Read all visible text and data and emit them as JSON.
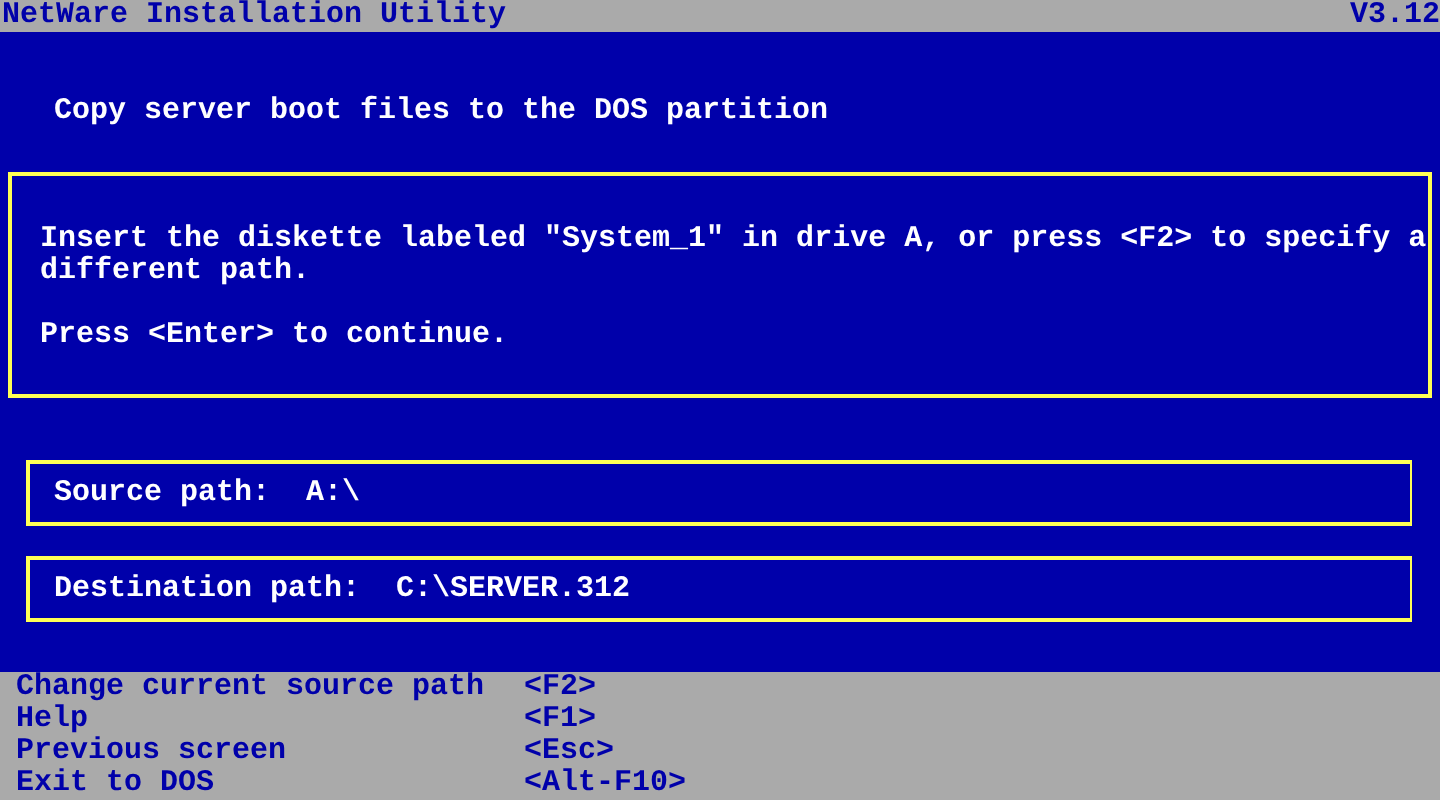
{
  "window": {
    "title": "NetWare Installation Utility",
    "version": "V3.12"
  },
  "heading": "Copy server boot files to the DOS partition",
  "message": [
    "Insert the diskette labeled \"System_1\" in drive A, or press <F2> to specify a different path.",
    "Press <Enter> to continue."
  ],
  "fields": [
    {
      "label": "Source path:",
      "value": "A:\\"
    },
    {
      "label": "Destination path:",
      "value": "C:\\SERVER.312"
    }
  ],
  "shortcuts": [
    {
      "action": "Change current source path",
      "key": "<F2>"
    },
    {
      "action": "Help",
      "key": "<F1>"
    },
    {
      "action": "Previous screen",
      "key": "<Esc>"
    },
    {
      "action": "Exit to DOS",
      "key": "<Alt-F10>"
    }
  ]
}
